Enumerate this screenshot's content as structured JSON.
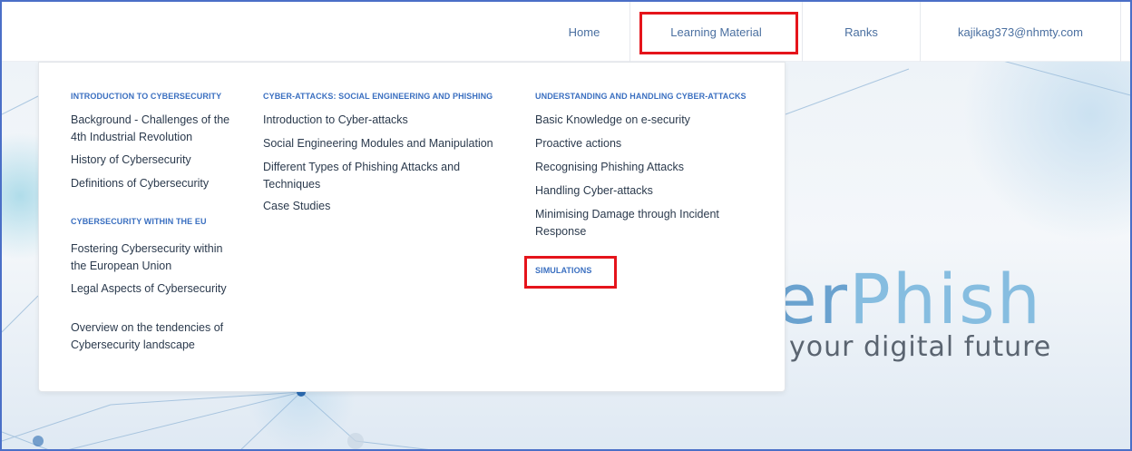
{
  "nav": {
    "items": [
      {
        "label": "Home"
      },
      {
        "label": "Learning Material"
      },
      {
        "label": "Ranks"
      },
      {
        "label": "kajikag373@nhmty.com"
      }
    ]
  },
  "menu": {
    "col1": {
      "section1_title": "INTRODUCTION TO CYBERSECURITY",
      "section1_links": [
        "Background - Challenges of the 4th Industrial Revolution",
        "History of Cybersecurity",
        "Definitions of Cybersecurity"
      ],
      "section2_title": "CYBERSECURITY WITHIN THE EU",
      "section2_links": [
        "Fostering Cybersecurity within the European Union",
        "Legal Aspects of Cybersecurity",
        "Overview on the tendencies of Cybersecurity landscape"
      ]
    },
    "col2": {
      "section_title": "CYBER-ATTACKS: SOCIAL ENGINEERING AND PHISHING",
      "links": [
        "Introduction to Cyber-attacks",
        "Social Engineering Modules and Manipulation",
        "Different Types of Phishing Attacks and Techniques",
        "Case Studies"
      ]
    },
    "col3": {
      "section_title": "UNDERSTANDING AND HANDLING CYBER-ATTACKS",
      "links": [
        "Basic Knowledge on e-security",
        "Proactive actions",
        "Recognising Phishing Attacks",
        "Handling Cyber-attacks",
        "Minimising Damage through Incident Response"
      ],
      "simulations_label": "SIMULATIONS"
    }
  },
  "hero": {
    "brand_part1": "er",
    "brand_part2": "Phish",
    "tagline": "your digital future"
  },
  "colors": {
    "accent": "#3a6fc0",
    "highlight": "#e5141b",
    "link": "#2b3a4d"
  }
}
